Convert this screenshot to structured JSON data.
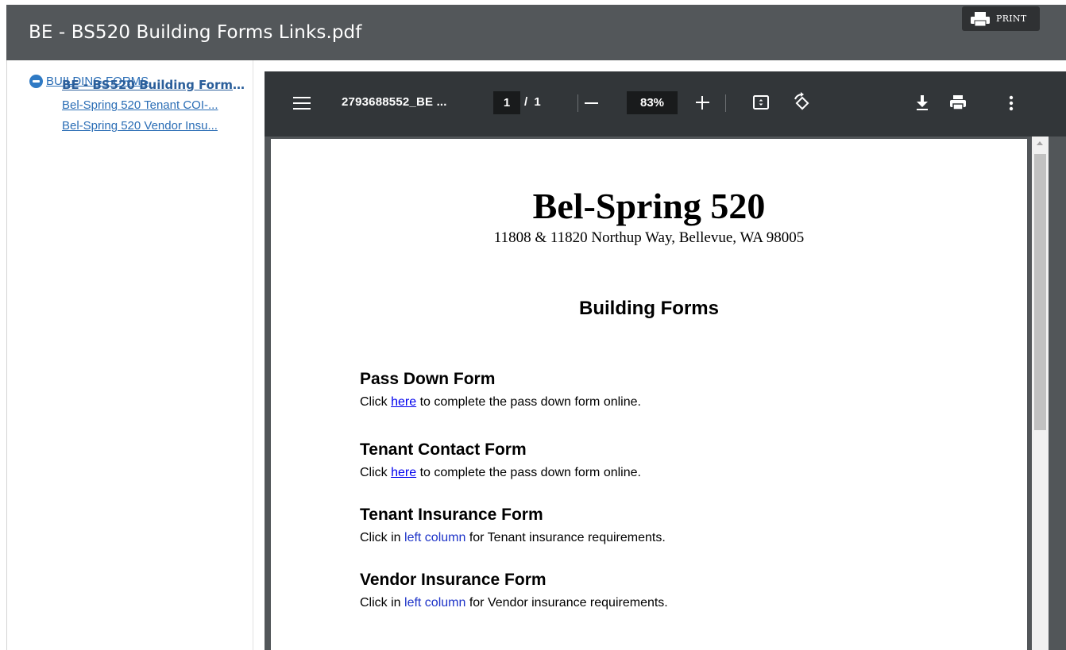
{
  "header": {
    "title": "BE - BS520 Building Forms Links.pdf",
    "print_label": "PRINT"
  },
  "sidebar": {
    "root_label": "BUILDING FORMS",
    "items": [
      {
        "label": "BE - BS520 Building Forms Links.pdf",
        "active": true
      },
      {
        "label": "Bel-Spring 520 Tenant COI-...",
        "active": false
      },
      {
        "label": "Bel-Spring 520 Vendor Insu...",
        "active": false
      }
    ]
  },
  "viewer": {
    "file_name": "2793688552_BE ...",
    "page_current": "1",
    "page_total": "/ 1",
    "zoom": "83%"
  },
  "document": {
    "title": "Bel-Spring 520",
    "address": "11808 & 11820 Northup Way, Bellevue, WA 98005",
    "subtitle": "Building Forms",
    "sections": [
      {
        "heading": "Pass Down Form",
        "pre": "Click ",
        "link": "here",
        "post": " to complete the pass down form online."
      },
      {
        "heading": "Tenant Contact Form",
        "pre": "Click ",
        "link": "here",
        "post": " to complete the pass down form online."
      },
      {
        "heading": "Tenant Insurance Form",
        "pre": "Click in ",
        "link": "left column",
        "post": " for Tenant insurance requirements."
      },
      {
        "heading": "Vendor Insurance Form",
        "pre": "Click in ",
        "link": "left column",
        "post": " for Vendor insurance requirements."
      }
    ]
  },
  "icons": {
    "print": "printer-icon",
    "menu": "hamburger-menu-icon",
    "fit": "fit-to-page-icon",
    "rotate": "rotate-icon",
    "download": "download-icon",
    "viewer_print": "printer-icon",
    "more": "more-vert-icon",
    "collapse": "minus-circle-icon"
  }
}
